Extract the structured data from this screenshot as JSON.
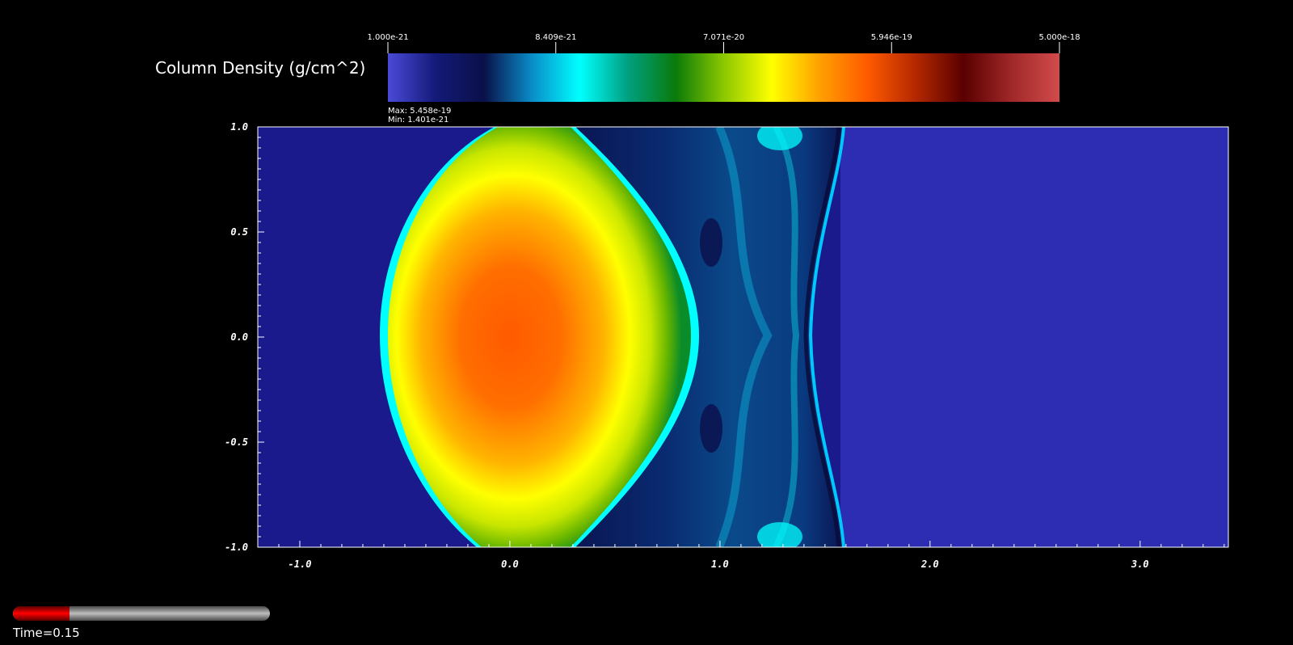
{
  "colorbar": {
    "title": "Column Density (g/cm^2)",
    "ticks": [
      "1.000e-21",
      "8.409e-21",
      "7.071e-20",
      "5.946e-19",
      "5.000e-18"
    ],
    "max_label": "Max:  5.458e-19",
    "min_label": "Min:  1.401e-21",
    "stops": [
      "#4a4ad8",
      "#131a78",
      "#0a1048",
      "#0a8cc8",
      "#00ffff",
      "#00a080",
      "#0a7a0a",
      "#8cc800",
      "#ffff00",
      "#ffa000",
      "#ff5a00",
      "#b42800",
      "#5a0000",
      "#a02828",
      "#d24b4b"
    ]
  },
  "plot": {
    "x_ticks": [
      "-1.0",
      "0.0",
      "1.0",
      "2.0",
      "3.0"
    ],
    "y_ticks": [
      "1.0",
      "0.5",
      "0.0",
      "-0.5",
      "-1.0"
    ],
    "x_range": [
      -1.2,
      3.42
    ],
    "y_range": [
      -1.0,
      1.0
    ],
    "background_color": "#1a1a8c",
    "ambient_color": "#2d2db4"
  },
  "time": {
    "label": "Time=0.15",
    "progress_fraction": 0.22
  }
}
